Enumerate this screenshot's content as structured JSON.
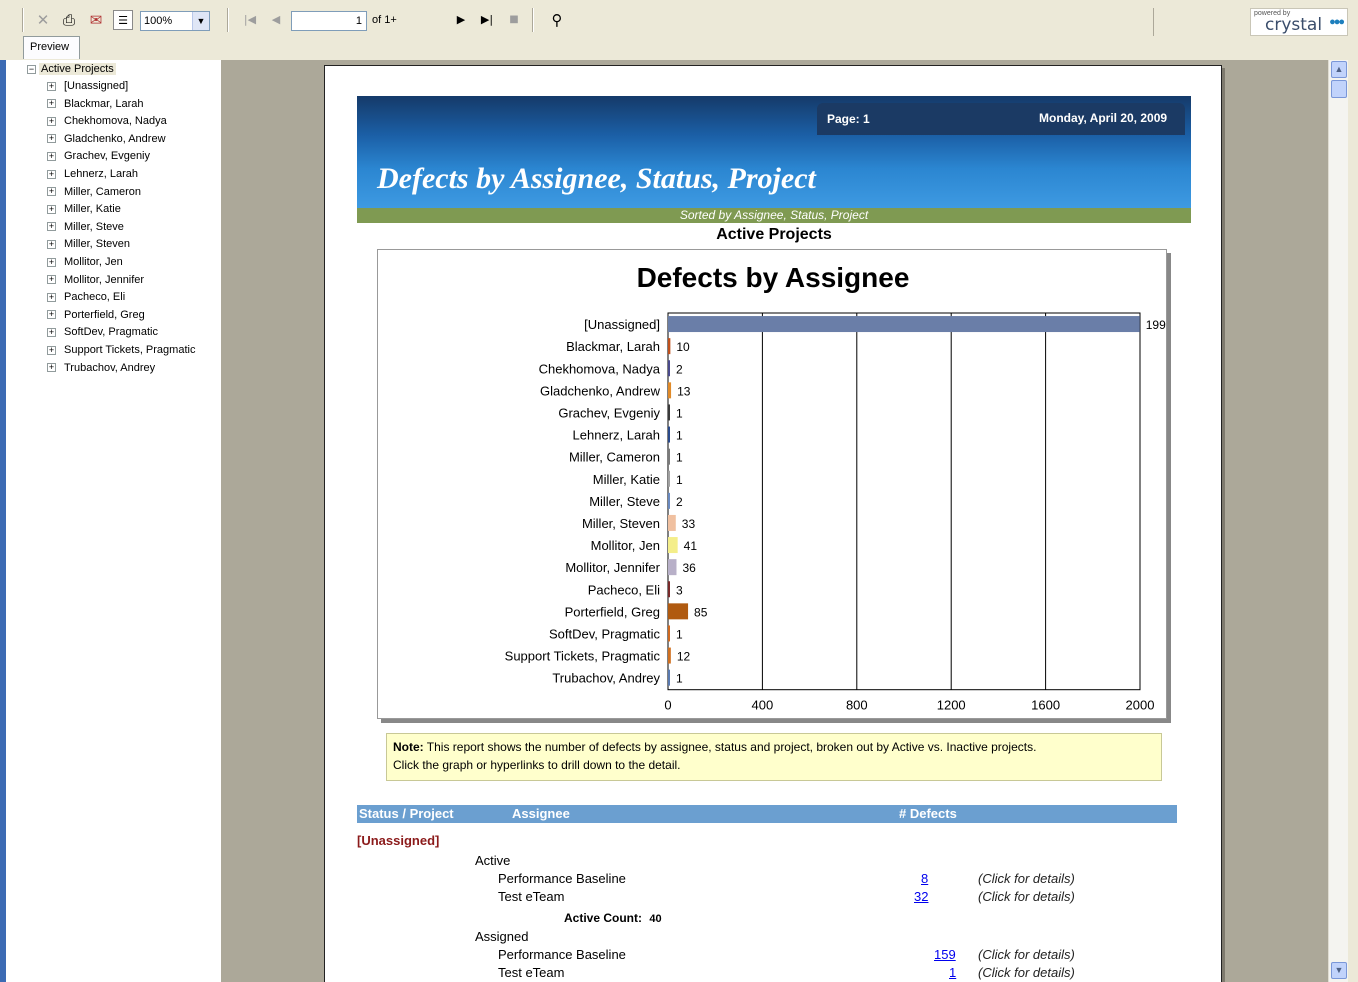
{
  "toolbar": {
    "zoom_value": "100%",
    "page_input": "1",
    "page_of": "of 1+",
    "icons": [
      "close-icon",
      "print-icon",
      "export-icon",
      "group-tree-icon",
      "first-page-icon",
      "prev-page-icon",
      "next-page-icon",
      "last-page-icon",
      "stop-icon",
      "search-binoculars-icon"
    ],
    "brand_small": "powered by",
    "brand": "crystal"
  },
  "tabs": {
    "preview": "Preview"
  },
  "tree": {
    "root": "Active Projects",
    "items": [
      "[Unassigned]",
      "Blackmar, Larah",
      "Chekhomova, Nadya",
      "Gladchenko, Andrew",
      "Grachev, Evgeniy",
      "Lehnerz, Larah",
      "Miller, Cameron",
      "Miller, Katie",
      "Miller, Steve",
      "Miller, Steven",
      "Mollitor, Jen",
      "Mollitor, Jennifer",
      "Pacheco, Eli",
      "Porterfield, Greg",
      "SoftDev, Pragmatic",
      "Support Tickets, Pragmatic",
      "Trubachov, Andrey"
    ]
  },
  "report": {
    "page_label": "Page: 1",
    "date": "Monday, April 20, 2009",
    "title": "Defects by Assignee, Status, Project",
    "subtitle": "Sorted by Assignee, Status, Project",
    "section": "Active Projects",
    "note_bold": "Note:",
    "note_line1": " This report shows the number of defects by assignee, status and project, broken out by Active vs. Inactive projects.",
    "note_line2": "Click the graph or hyperlinks to drill down to the detail.",
    "table_headers": {
      "status_project": "Status / Project",
      "assignee": "Assignee",
      "defects": "# Defects"
    },
    "group_name": "[Unassigned]",
    "active_label": "Active",
    "active_rows": [
      {
        "project": "Performance Baseline",
        "count": "8",
        "hint": "(Click for details)"
      },
      {
        "project": "Test eTeam",
        "count": "32",
        "hint": "(Click for details)"
      }
    ],
    "active_count_label": "Active Count:",
    "active_count_value": "40",
    "assigned_label": "Assigned",
    "assigned_rows": [
      {
        "project": "Performance Baseline",
        "count": "159",
        "hint": "(Click for details)"
      },
      {
        "project": "Test eTeam",
        "count": "1",
        "hint": "(Click for details)"
      }
    ]
  },
  "chart_data": {
    "type": "bar",
    "orientation": "horizontal",
    "title": "Defects by Assignee",
    "categories": [
      "[Unassigned]",
      "Blackmar, Larah",
      "Chekhomova, Nadya",
      "Gladchenko, Andrew",
      "Grachev, Evgeniy",
      "Lehnerz, Larah",
      "Miller, Cameron",
      "Miller, Katie",
      "Miller, Steve",
      "Miller, Steven",
      "Mollitor, Jen",
      "Mollitor, Jennifer",
      "Pacheco, Eli",
      "Porterfield, Greg",
      "SoftDev, Pragmatic",
      "Support Tickets, Pragmatic",
      "Trubachov, Andrey"
    ],
    "values": [
      1999,
      10,
      2,
      13,
      1,
      1,
      1,
      1,
      2,
      33,
      41,
      36,
      3,
      85,
      1,
      12,
      1
    ],
    "value_labels": [
      "199",
      "10",
      "2",
      "13",
      "1",
      "1",
      "1",
      "1",
      "2",
      "33",
      "41",
      "36",
      "3",
      "85",
      "1",
      "12",
      "1"
    ],
    "colors": [
      "#6a7ea8",
      "#c0501c",
      "#4a4a8c",
      "#e08a28",
      "#3a3a3a",
      "#2a4a8a",
      "#7a7a7a",
      "#a0a0a0",
      "#6a8ac0",
      "#f0c0a0",
      "#f4ee8a",
      "#b8b0c8",
      "#7a2a2a",
      "#b05a10",
      "#d06a20",
      "#d07020",
      "#5a7ab0"
    ],
    "xlim": [
      0,
      2000
    ],
    "xticks": [
      "0",
      "400",
      "800",
      "1200",
      "1600",
      "2000"
    ],
    "grid": true
  }
}
